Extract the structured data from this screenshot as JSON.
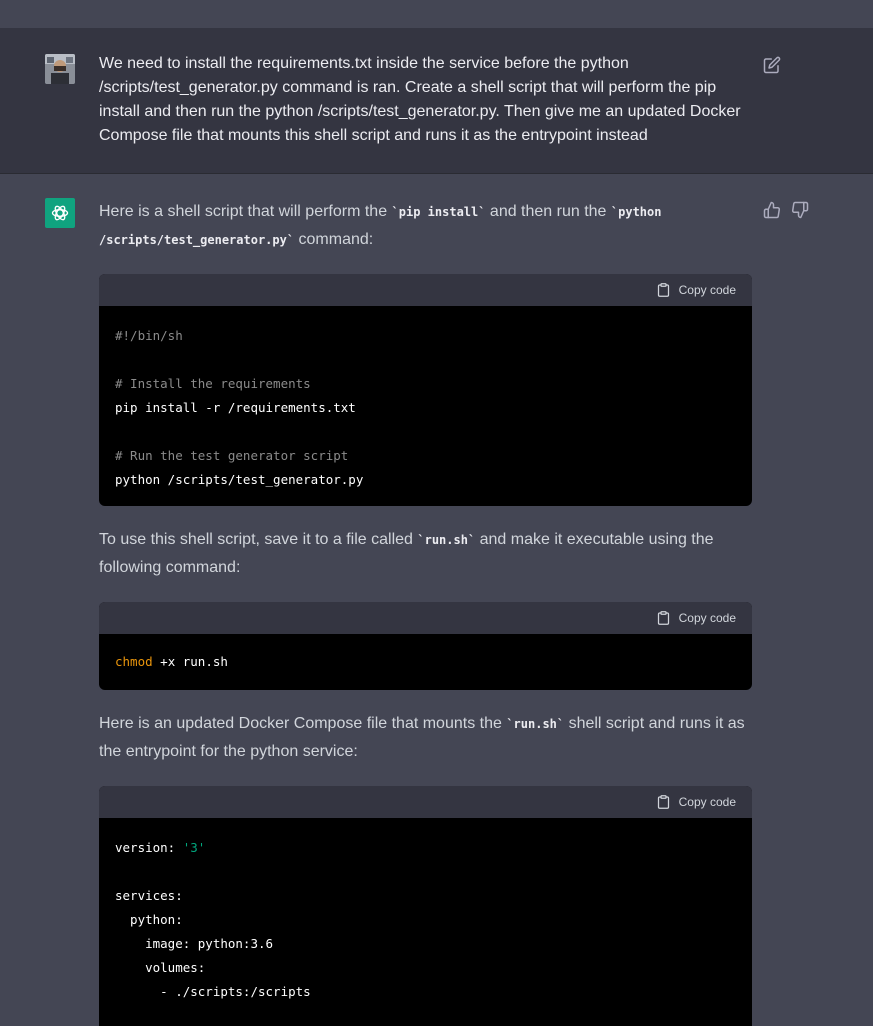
{
  "user_message": {
    "text": "We need to install the requirements.txt inside the service before the python /scripts/test_generator.py command is ran. Create a shell script that will perform the pip install and then run the python /scripts/test_generator.py. Then give me an updated Docker Compose file that mounts this shell script and runs it as the entrypoint instead"
  },
  "assistant": {
    "intro": {
      "pre": "Here is a shell script that will perform the ",
      "code1": "`pip install`",
      "mid": " and then run the ",
      "code2": "`python /scripts/test_generator.py`",
      "post": " command:"
    },
    "code_block_1": {
      "copy_label": "Copy code",
      "lines": {
        "l1": "#!/bin/sh",
        "l3": "# Install the requirements",
        "l4": "pip install -r /requirements.txt",
        "l6": "# Run the test generator script",
        "l7": "python /scripts/test_generator.py"
      }
    },
    "para2": {
      "pre": "To use this shell script, save it to a file called ",
      "code": "`run.sh`",
      "post": " and make it executable using the following command:"
    },
    "code_block_2": {
      "copy_label": "Copy code",
      "cmd": "chmod",
      "args": " +x run.sh"
    },
    "para3": {
      "pre": "Here is an updated Docker Compose file that mounts the ",
      "code": "`run.sh`",
      "post": " shell script and runs it as the entrypoint for the python service:"
    },
    "code_block_3": {
      "copy_label": "Copy code",
      "lines": {
        "version_key": "version: ",
        "version_val": "'3'",
        "services": "services:",
        "python": "  python:",
        "image": "    image: python:3.6",
        "volumes": "    volumes:",
        "vol1": "      - ./scripts:/scripts"
      }
    }
  },
  "colors": {
    "user_bg": "#343541",
    "assistant_bg": "#444654",
    "gpt_green": "#10a37f",
    "code_bg": "#000000",
    "comment": "#8b8b8b",
    "builtin": "#e9950c",
    "string": "#00a67d"
  },
  "icons": [
    "edit-icon",
    "openai-logo-icon",
    "thumbs-up-icon",
    "thumbs-down-icon",
    "clipboard-icon"
  ]
}
